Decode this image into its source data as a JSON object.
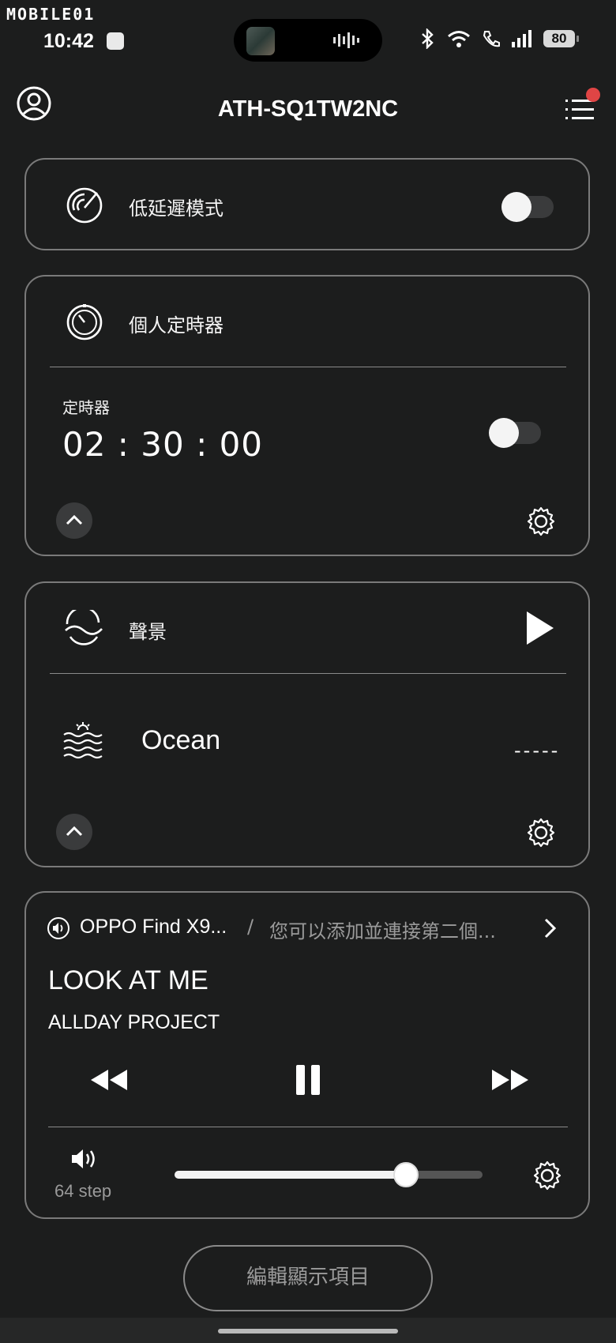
{
  "status_bar": {
    "watermark": "MOBILE01",
    "time": "10:42",
    "battery": "80",
    "icons": [
      "bluetooth-icon",
      "wifi-icon",
      "wifi-call-icon",
      "signal-icon",
      "battery-icon"
    ]
  },
  "header": {
    "title": "ATH-SQ1TW2NC",
    "icons": [
      "account-icon",
      "menu-icon"
    ]
  },
  "low_latency": {
    "label": "低延遲模式",
    "enabled": false
  },
  "timer": {
    "title": "個人定時器",
    "sub_label": "定時器",
    "value": "02 : 30 : 00",
    "enabled": false
  },
  "soundscape": {
    "title": "聲景",
    "item": "Ocean",
    "status": "-----"
  },
  "player": {
    "device": "OPPO Find X9...",
    "separator": "/",
    "hint": "您可以添加並連接第二個...",
    "song": "LOOK AT ME",
    "artist": "ALLDAY PROJECT",
    "volume_label": "64 step",
    "volume_fraction": 0.75
  },
  "footer": {
    "edit_label": "編輯顯示項目"
  },
  "colors": {
    "background": "#1c1d1d",
    "badge": "#e04545",
    "border": "#7a7a7a"
  }
}
